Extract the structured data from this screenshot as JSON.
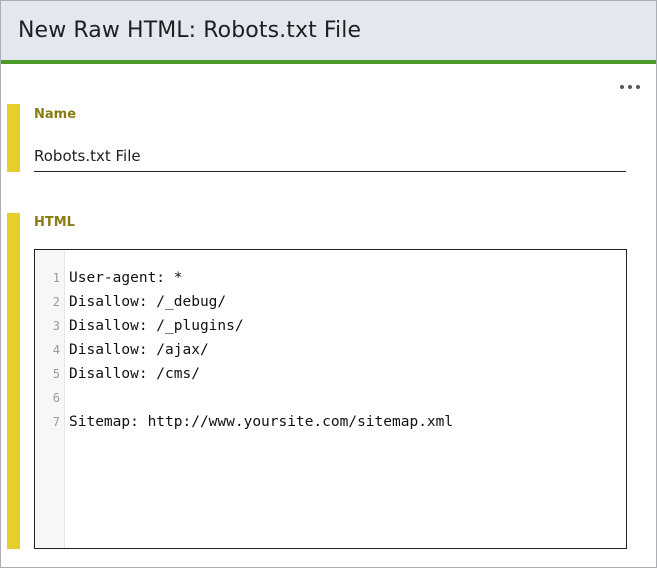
{
  "header": {
    "title": "New Raw HTML: Robots.txt File"
  },
  "toolbar": {
    "more_label": "…"
  },
  "fields": {
    "name": {
      "label": "Name",
      "value": "Robots.txt File"
    },
    "html": {
      "label": "HTML",
      "line_numbers": [
        "1",
        "2",
        "3",
        "4",
        "5",
        "6",
        "7"
      ],
      "lines": [
        "User-agent: *",
        "Disallow: /_debug/",
        "Disallow: /_plugins/",
        "Disallow: /ajax/",
        "Disallow: /cms/",
        "",
        "Sitemap: http://www.yoursite.com/sitemap.xml"
      ]
    }
  },
  "colors": {
    "header_bg": "#e3e7f0",
    "header_accent": "#4e9a2a",
    "field_marker": "#e6cf2c",
    "field_label": "#8a7a12"
  }
}
